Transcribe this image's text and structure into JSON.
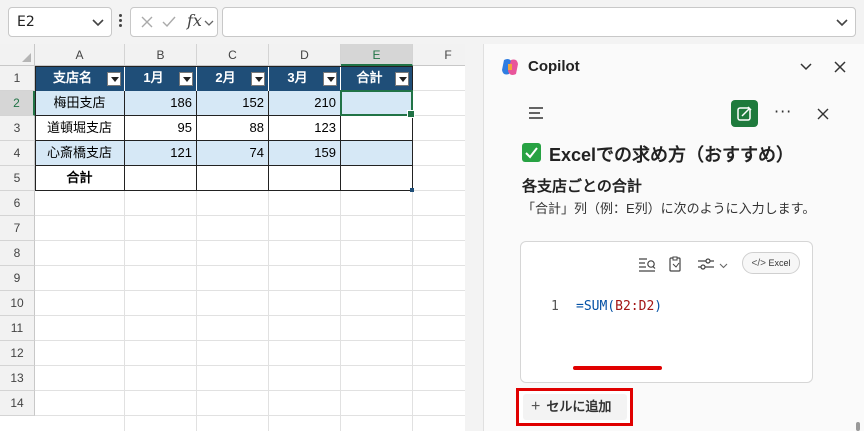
{
  "formula_bar": {
    "name_box": "E2",
    "fx_label": "fx",
    "formula_value": ""
  },
  "sheet": {
    "columns": [
      "A",
      "B",
      "C",
      "D",
      "E",
      "F"
    ],
    "rows": [
      "1",
      "2",
      "3",
      "4",
      "5",
      "6",
      "7",
      "8",
      "9",
      "10",
      "11",
      "12",
      "13",
      "14"
    ],
    "selected_cell": "E2",
    "table": {
      "headers": [
        "支店名",
        "1月",
        "2月",
        "3月",
        "合計"
      ],
      "rows": [
        [
          "梅田支店",
          "186",
          "152",
          "210",
          ""
        ],
        [
          "道頓堀支店",
          "95",
          "88",
          "123",
          ""
        ],
        [
          "心斎橋支店",
          "121",
          "74",
          "159",
          ""
        ]
      ],
      "total_row": [
        "合計",
        "",
        "",
        "",
        ""
      ]
    },
    "colors": {
      "header_fill": "#1f4e78",
      "band_fill": "#d6e8f6",
      "selection": "#217346"
    }
  },
  "copilot": {
    "title": "Copilot",
    "heading": "Excelでの求め方（おすすめ）",
    "subheading": "各支店ごとの合計",
    "paragraph": "「合計」列（例：E列）に次のように入力します。",
    "code_block": {
      "line_number": "1",
      "code_prefix": "=SUM(",
      "code_ref": "B2:D2",
      "code_suffix": ")",
      "excel_button": "Excel"
    },
    "add_to_cell_button": "セルに追加",
    "colors": {
      "new_chat": "#1e7a3c",
      "check": "#27a243",
      "annotation": "#e00000"
    }
  }
}
